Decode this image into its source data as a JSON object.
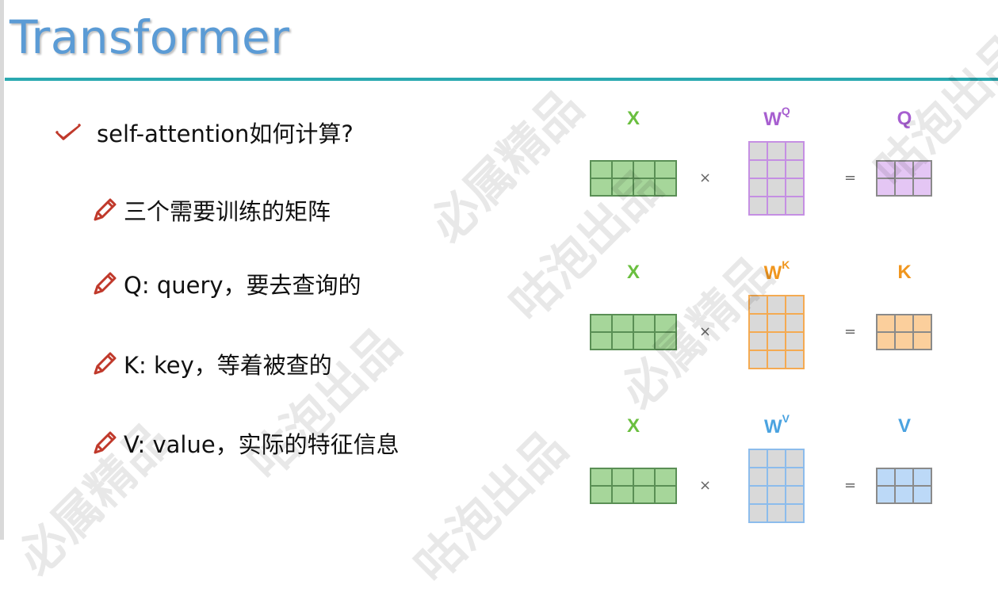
{
  "title": "Transformer",
  "main_bullet": "self-attention如何计算?",
  "sub_bullets": [
    "三个需要训练的矩阵",
    "Q: query，要去查询的",
    "K: key，等着被查的",
    "V: value，实际的特征信息"
  ],
  "rows": [
    {
      "input": "X",
      "weight": "W",
      "weight_sup": "Q",
      "output": "Q",
      "color": "#a75fd0",
      "fill": "#e4c6f4",
      "border": "#c58fe3"
    },
    {
      "input": "X",
      "weight": "W",
      "weight_sup": "K",
      "output": "K",
      "color": "#f0961e",
      "fill": "#fbcf9c",
      "border": "#f4aa52"
    },
    {
      "input": "X",
      "weight": "W",
      "weight_sup": "V",
      "output": "V",
      "color": "#4ba3e0",
      "fill": "#bcd9f7",
      "border": "#8cbcec"
    }
  ],
  "input_color": "#6abf3f",
  "input_fill": "#a6d69a",
  "times": "×",
  "equals": "=",
  "watermarks": [
    "必属精品",
    "咕泡出品",
    "咕泡出品",
    "必属精品",
    "必属精品",
    "咕泡出品",
    "咕泡出品"
  ]
}
